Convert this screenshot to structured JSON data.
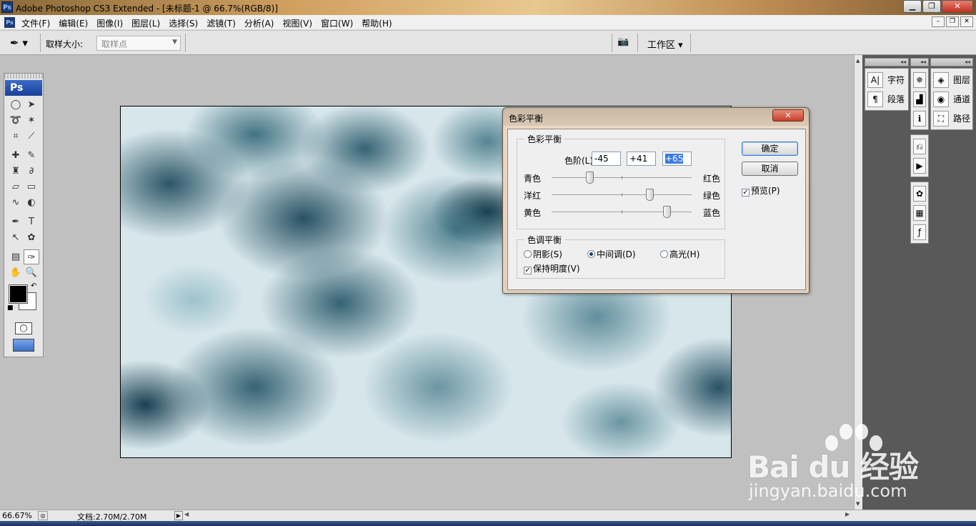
{
  "titlebar": {
    "logo": "Ps",
    "title": "Adobe Photoshop CS3 Extended - [未标题-1 @ 66.7%(RGB/8)]",
    "buttons": [
      "▁",
      "❐",
      "✕"
    ]
  },
  "menubar": {
    "doc_icon": "Ps",
    "items": [
      "文件(F)",
      "编辑(E)",
      "图像(I)",
      "图层(L)",
      "选择(S)",
      "滤镜(T)",
      "分析(A)",
      "视图(V)",
      "窗口(W)",
      "帮助(H)"
    ],
    "mdi_buttons": [
      "–",
      "❐",
      "✕"
    ]
  },
  "optbar": {
    "tool_icon": "eyedropper-icon",
    "sample_size_label": "取样大小:",
    "sample_size_value": "取样点",
    "workspace_label": "工作区 ▾"
  },
  "toolbox": {
    "logo": "Ps",
    "foreground_color": "#000000",
    "background_color": "#ffffff"
  },
  "dock": {
    "col1": [
      {
        "icon": "A|",
        "label": "字符"
      },
      {
        "icon": "¶",
        "label": "段落"
      }
    ],
    "col3": [
      {
        "icon": "◈",
        "label": "图层"
      },
      {
        "icon": "◉",
        "label": "通道"
      },
      {
        "icon": "⛶",
        "label": "路径"
      }
    ]
  },
  "dialog": {
    "title": "色彩平衡",
    "close": "✕",
    "color_balance": {
      "legend": "色彩平衡",
      "levels_label": "色阶(L):",
      "levels": [
        "-45",
        "+41",
        "+65"
      ],
      "sliders": [
        {
          "left": "青色",
          "right": "红色",
          "value": -45
        },
        {
          "left": "洋红",
          "right": "绿色",
          "value": 41
        },
        {
          "left": "黄色",
          "right": "蓝色",
          "value": 65
        }
      ]
    },
    "tone_balance": {
      "legend": "色调平衡",
      "options": [
        "阴影(S)",
        "中间调(D)",
        "高光(H)"
      ],
      "selected": "中间调(D)",
      "preserve_label": "保持明度(V)",
      "preserve_checked": true
    },
    "ok_label": "确定",
    "cancel_label": "取消",
    "preview_label": "预览(P)",
    "preview_checked": true
  },
  "status": {
    "zoom": "66.67%",
    "doc_info": "文档:2.70M/2.70M"
  },
  "watermark": {
    "brand": "Bai du 经验",
    "url": "jingyan.baidu.com"
  }
}
